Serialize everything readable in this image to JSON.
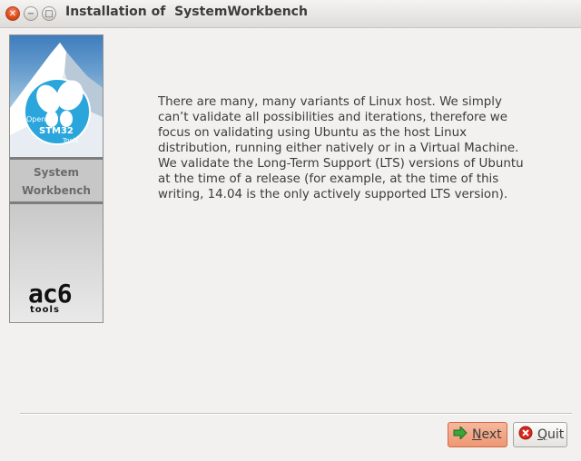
{
  "window": {
    "title": "Installation of  SystemWorkbench",
    "close_glyph": "✕",
    "minimize_glyph": "−",
    "maximize_glyph": "□"
  },
  "banner": {
    "logo_line1": "Open",
    "logo_line2": "STM32",
    "logo_line3": "Tools",
    "name_line1": "System",
    "name_line2": "Workbench",
    "brand_main": "ac6",
    "brand_sub": "tools"
  },
  "description": "There are many, many variants of Linux host. We simply can’t validate all possibilities and iterations, therefore we focus on validating using Ubuntu as the host Linux distribution, running either natively or in a Virtual Machine. We validate the Long-Term Support (LTS) versions of Ubuntu at the time of a release (for example, at the time of this writing, 14.04 is the only actively supported LTS version).",
  "buttons": {
    "next_mnemonic": "N",
    "next_rest": "ext",
    "quit_mnemonic": "Q",
    "quit_rest": "uit"
  },
  "colors": {
    "next_bg": "#ee9873",
    "close_bg": "#dd4814",
    "logo_circle": "#2aa6dc"
  }
}
